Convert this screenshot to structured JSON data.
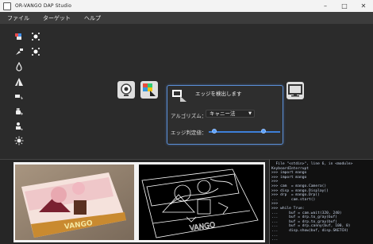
{
  "window": {
    "title": "OR-VANGO DAP Studio",
    "min": "–",
    "max": "□",
    "close": "✕"
  },
  "menu": [
    "ファイル",
    "ターゲット",
    "ヘルプ"
  ],
  "palette_icons": [
    "color-image-icon",
    "scatter-icon",
    "colorize-icon",
    "scatter-icon",
    "droplet-icon",
    "triangle-icon",
    "edit-icon",
    "hand-icon",
    "person-icon",
    "brightness-icon"
  ],
  "dialog": {
    "title": "エッジを検出します",
    "algo_label": "アルゴリズム：",
    "algo_value": "キャニー法",
    "threshold_label": "エッジ判定値：",
    "knob_positions": [
      0.08,
      0.77
    ]
  },
  "photo_caption": "VANGO",
  "edges_caption": "VANGO",
  "console_lines": [
    "  File \"<stdin>\", line 6, in <module>",
    "KeyboardInterrupt",
    ">>> import mango",
    ">>> import mango",
    ">>>",
    ">>> cam  = mango.Camera()",
    ">>> disp = mango.Display()",
    ">>> drp  = mango.Drp()",
    "...      cam.start()",
    ">>>",
    ">>> while True:",
    "...     buf = cam.wait(320, 240)",
    "...     buf = drp.to_gray(buf)",
    "...     buf = drp.to_gray(buf)",
    "...     buf = drp.canny(buf, 100, 0)",
    "...     disp.show(buf, disp.SKETCH)",
    "...",
    "..."
  ]
}
